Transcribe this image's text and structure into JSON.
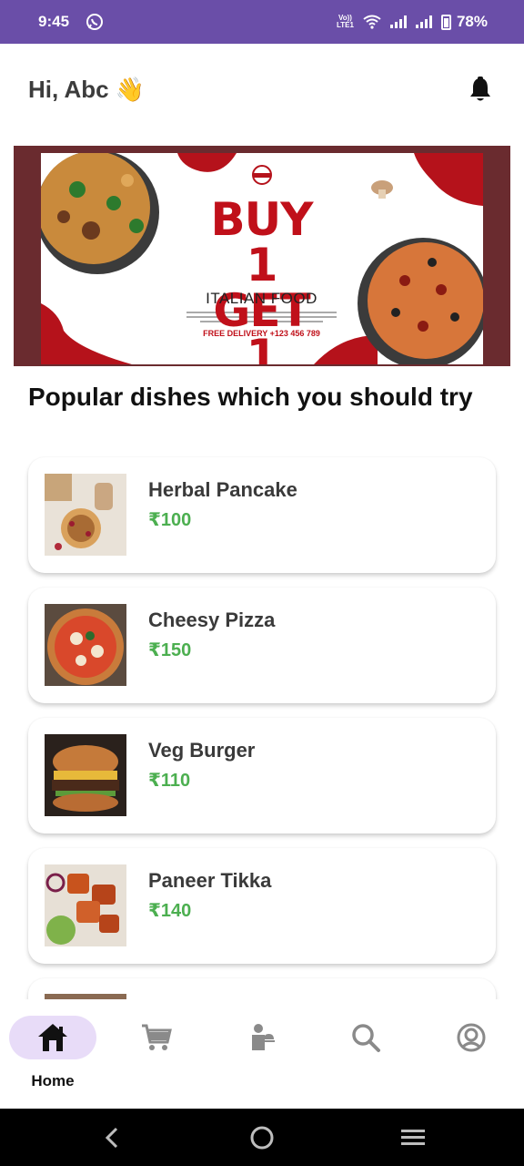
{
  "status_bar": {
    "time": "9:45",
    "network": "Vo)) LTE1",
    "battery": "78%"
  },
  "header": {
    "greeting": "Hi, Abc",
    "greeting_emoji": "👋"
  },
  "banner": {
    "headline_line1": "BUY 1",
    "headline_line2": "GET 1",
    "subheadline": "ITALIAN FOOD",
    "delivery_text": "FREE DELIVERY +123 456 789"
  },
  "section": {
    "title": "Popular dishes which you should try"
  },
  "dishes": [
    {
      "name": "Herbal Pancake",
      "price": "₹100"
    },
    {
      "name": "Cheesy Pizza",
      "price": "₹150"
    },
    {
      "name": "Veg Burger",
      "price": "₹110"
    },
    {
      "name": "Paneer Tikka",
      "price": "₹140"
    }
  ],
  "bottom_nav": {
    "active_label": "Home"
  },
  "colors": {
    "status_bar": "#6a4ea8",
    "accent_pill": "#e8dcf8",
    "price_green": "#4caf50",
    "banner_red": "#c0101a"
  }
}
